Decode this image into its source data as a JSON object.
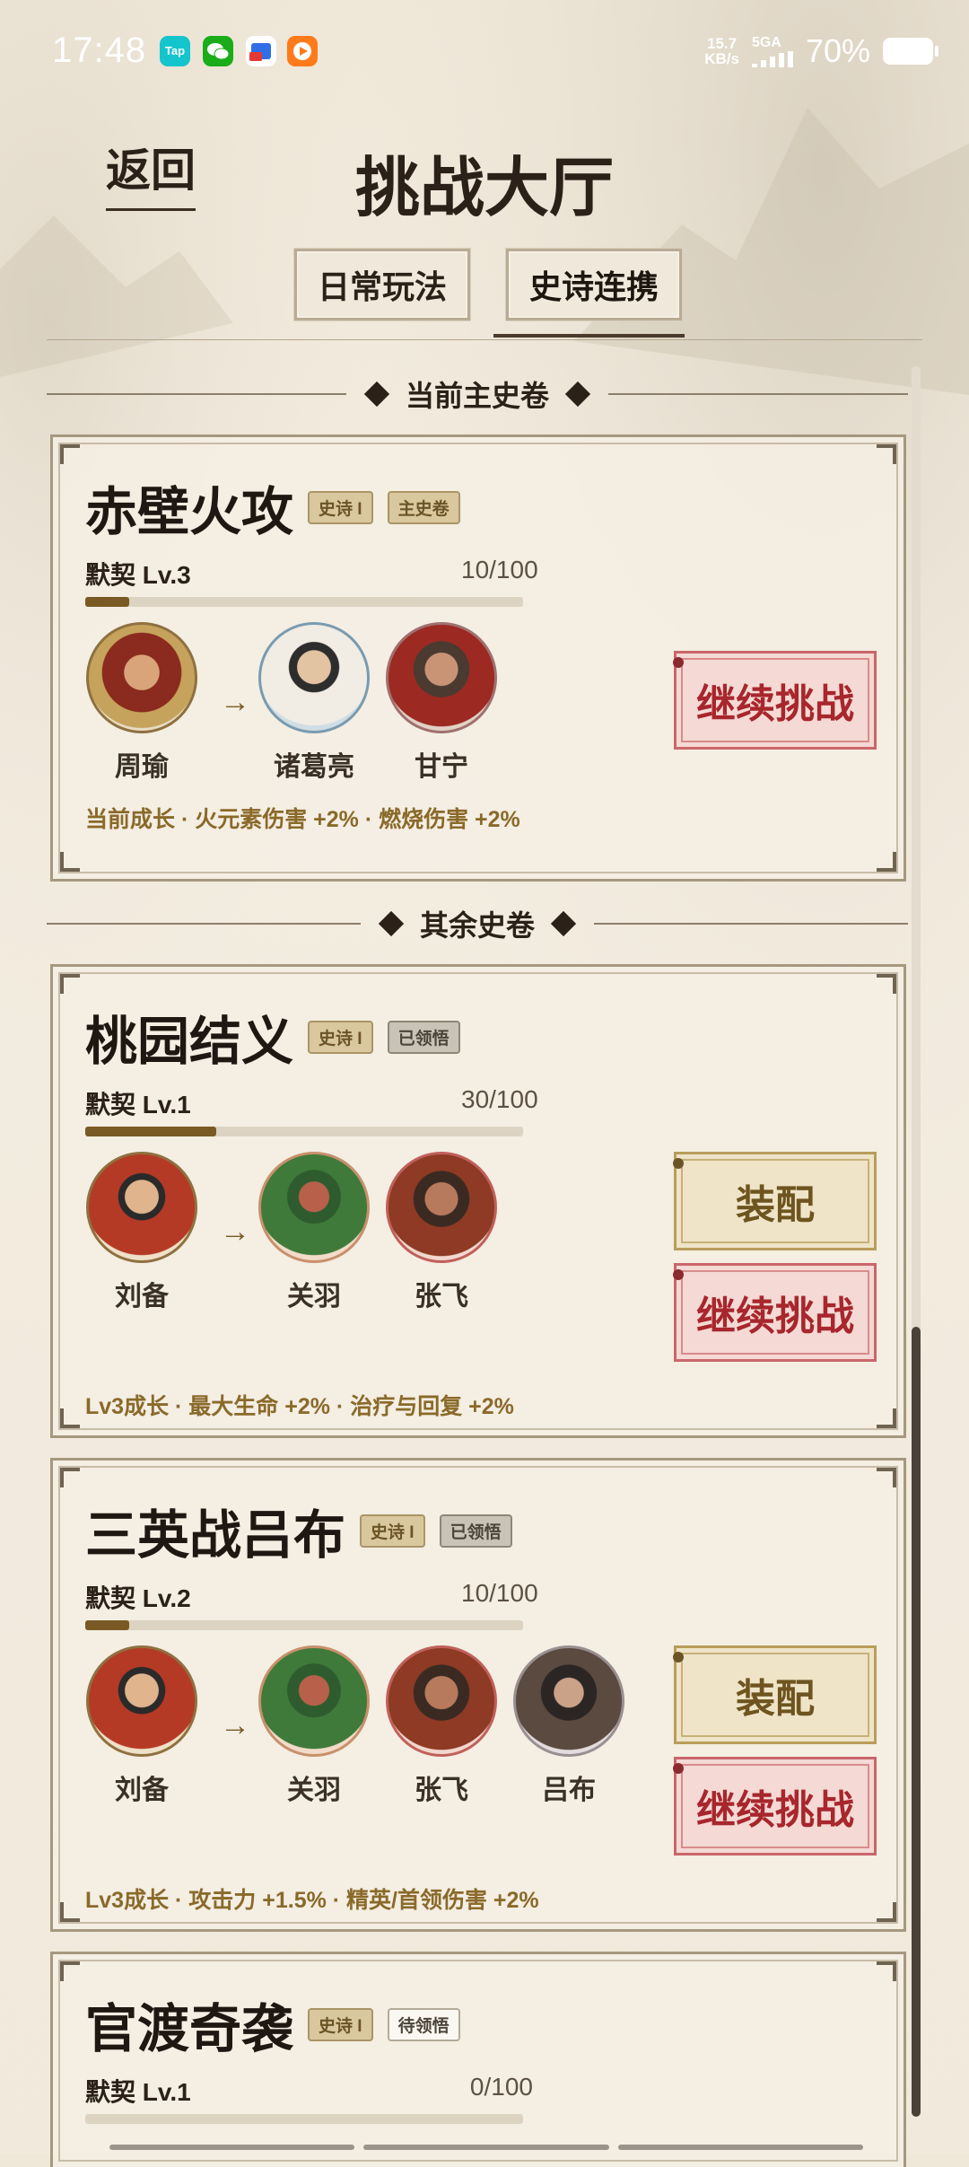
{
  "status": {
    "time": "17:48",
    "net_speed_top": "15.7",
    "net_speed_bottom": "KB/s",
    "signal": "5GA",
    "battery": "70%",
    "app_icons": [
      {
        "name": "taptap-icon",
        "text": "Tap",
        "color": "#15c5ce"
      },
      {
        "name": "wechat-icon",
        "color": "#1aad19"
      },
      {
        "name": "cloud-app-icon",
        "color": "#2f6ee6"
      },
      {
        "name": "video-app-icon",
        "color": "#ff7a1a"
      }
    ]
  },
  "header": {
    "back_label": "返回",
    "title": "挑战大厅"
  },
  "tabs": [
    {
      "label": "日常玩法",
      "active": false
    },
    {
      "label": "史诗连携",
      "active": true
    }
  ],
  "sections": {
    "current": "当前主史卷",
    "others": "其余史卷"
  },
  "cards": [
    {
      "title": "赤壁火攻",
      "tags": [
        "史诗 I",
        "主史卷"
      ],
      "level": "默契 Lv.3",
      "progress": "10/100",
      "progress_ratio": 0.1,
      "heroes": [
        "周瑜",
        "诸葛亮",
        "甘宁"
      ],
      "bonus": "当前成长 · 火元素伤害 +2% · 燃烧伤害 +2%",
      "buttons": [
        "继续挑战"
      ]
    },
    {
      "title": "桃园结义",
      "tags": [
        "史诗 I",
        "已领悟"
      ],
      "level": "默契 Lv.1",
      "progress": "30/100",
      "progress_ratio": 0.3,
      "heroes": [
        "刘备",
        "关羽",
        "张飞"
      ],
      "bonus": "Lv3成长 · 最大生命 +2% · 治疗与回复 +2%",
      "buttons": [
        "装配",
        "继续挑战"
      ]
    },
    {
      "title": "三英战吕布",
      "tags": [
        "史诗 I",
        "已领悟"
      ],
      "level": "默契 Lv.2",
      "progress": "10/100",
      "progress_ratio": 0.1,
      "heroes": [
        "刘备",
        "关羽",
        "张飞",
        "吕布"
      ],
      "bonus": "Lv3成长 · 攻击力 +1.5% · 精英/首领伤害 +2%",
      "buttons": [
        "装配",
        "继续挑战"
      ]
    },
    {
      "title": "官渡奇袭",
      "tags": [
        "史诗 I",
        "待领悟"
      ],
      "level": "默契 Lv.1",
      "progress": "0/100",
      "progress_ratio": 0.0
    }
  ]
}
